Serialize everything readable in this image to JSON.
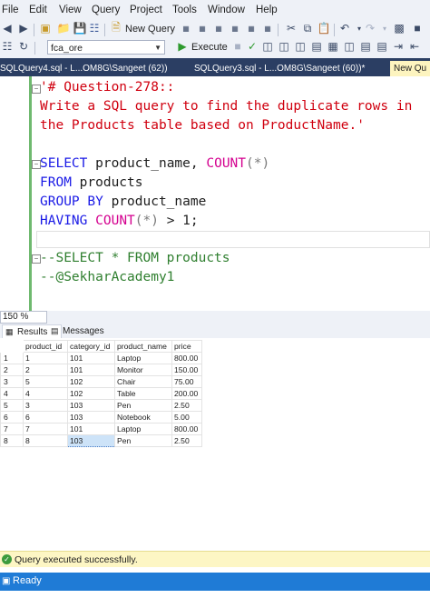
{
  "menu": [
    "File",
    "Edit",
    "View",
    "Query",
    "Project",
    "Tools",
    "Window",
    "Help"
  ],
  "toolbar": {
    "new_query": "New Query",
    "database": "fca_ore",
    "execute": "Execute"
  },
  "tabs": [
    {
      "label": "SQLQuery4.sql - L...OM8G\\Sangeet (62))",
      "active": false
    },
    {
      "label": "SQLQuery3.sql - L...OM8G\\Sangeet (60))*",
      "active": false
    },
    {
      "label": "New Qu",
      "active": true
    }
  ],
  "editor": {
    "comment_lines": [
      "'# Question-278::",
      "Write a SQL query to find the duplicate rows in",
      "the Products table based on ProductName.'"
    ],
    "select_kw": "SELECT",
    "select_col": "product_name,",
    "count_fn": "COUNT",
    "count_arg": "(*)",
    "from_kw": "FROM",
    "from_tbl": "products",
    "group_kw": "GROUP BY",
    "group_col": "product_name",
    "having_kw": "HAVING",
    "having_cond": " > 1;",
    "note1": "--SELECT * FROM products",
    "note2": "--@SekharAcademy1"
  },
  "zoom": "150 %",
  "results_tabs": {
    "results": "Results",
    "messages": "Messages"
  },
  "results": {
    "columns": [
      "product_id",
      "category_id",
      "product_name",
      "price"
    ],
    "rows": [
      [
        "1",
        "1",
        "101",
        "Laptop",
        "800.00"
      ],
      [
        "2",
        "2",
        "101",
        "Monitor",
        "150.00"
      ],
      [
        "3",
        "5",
        "102",
        "Chair",
        "75.00"
      ],
      [
        "4",
        "4",
        "102",
        "Table",
        "200.00"
      ],
      [
        "5",
        "3",
        "103",
        "Pen",
        "2.50"
      ],
      [
        "6",
        "6",
        "103",
        "Notebook",
        "5.00"
      ],
      [
        "7",
        "7",
        "101",
        "Laptop",
        "800.00"
      ],
      [
        "8",
        "8",
        "103",
        "Pen",
        "2.50"
      ]
    ]
  },
  "status": {
    "message": "Query executed successfully.",
    "ready": "Ready"
  }
}
